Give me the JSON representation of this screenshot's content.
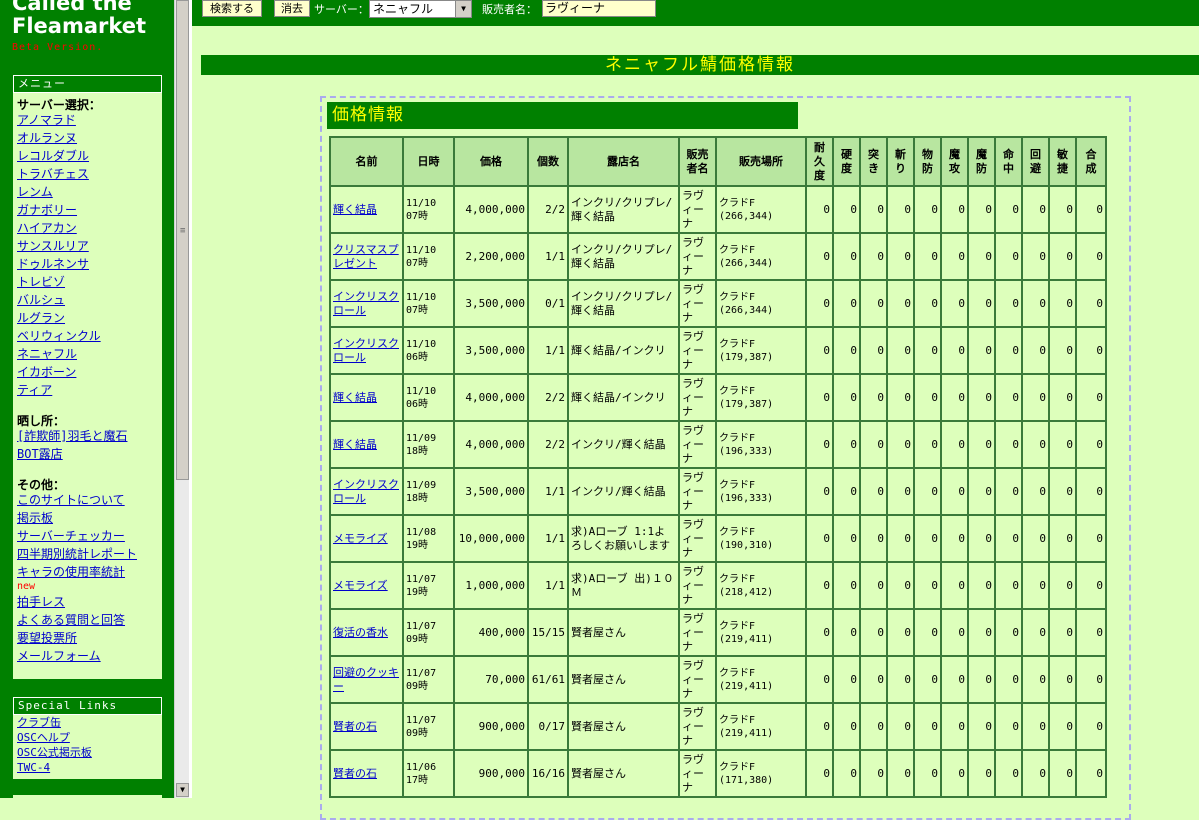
{
  "site": {
    "title_line1": "Called the",
    "title_line2": "Fleamarket",
    "beta": "Beta Version."
  },
  "menu": {
    "header": "メニュー",
    "server_section": "サーバー選択：",
    "servers": [
      "アノマラド",
      "オルランヌ",
      "レコルダブル",
      "トラバチェス",
      "レンム",
      "ガナボリー",
      "ハイアカン",
      "サンスルリア",
      "ドゥルネンサ",
      "トレビゾ",
      "バルシュ",
      "ルグラン",
      "ベリウィンクル",
      "ネニャフル",
      "イカボーン",
      "ティア"
    ],
    "exposure_section": "晒し所：",
    "exposure_links": [
      "[詐欺師]羽毛と魔石",
      "BOT露店"
    ],
    "other_section": "その他：",
    "other_links_a": [
      "このサイトについて",
      "掲示板",
      "サーバーチェッカー",
      "四半期別統計レポート",
      "キャラの使用率統計"
    ],
    "new_tag": "new",
    "other_links_b": [
      "拍手レス",
      "よくある質問と回答",
      "要望投票所",
      "メールフォーム"
    ]
  },
  "special": {
    "header": "Special Links",
    "links": [
      "クラブ缶",
      "OSCヘルプ",
      "OSC公式掲示板",
      "TWC-4"
    ]
  },
  "form": {
    "search_button": "検索する",
    "clear_button": "消去",
    "server_label": "サーバー：",
    "server_value": "ネニャフル",
    "seller_label": "販売者名：",
    "seller_value": "ラヴィーナ"
  },
  "banner": "ネニャフル鯖価格情報",
  "panel_title": "価格情報",
  "table": {
    "headers": [
      "名前",
      "日時",
      "価格",
      "個数",
      "露店名",
      "販売者名",
      "販売場所",
      "耐久度",
      "硬度",
      "突き",
      "斬り",
      "物防",
      "魔攻",
      "魔防",
      "命中",
      "回避",
      "敏捷",
      "合成"
    ],
    "rows": [
      {
        "name": "輝く結晶",
        "date": "11/10 07時",
        "price": "4,000,000",
        "qty": "2/2",
        "shop": "インクリ/クリプレ/輝く結晶",
        "seller": "ラヴィーナ",
        "loc": "クラドF (266,344)",
        "stats": [
          "0",
          "0",
          "0",
          "0",
          "0",
          "0",
          "0",
          "0",
          "0",
          "0",
          "0"
        ]
      },
      {
        "name": "クリスマスプレゼント",
        "date": "11/10 07時",
        "price": "2,200,000",
        "qty": "1/1",
        "shop": "インクリ/クリプレ/輝く結晶",
        "seller": "ラヴィーナ",
        "loc": "クラドF (266,344)",
        "stats": [
          "0",
          "0",
          "0",
          "0",
          "0",
          "0",
          "0",
          "0",
          "0",
          "0",
          "0"
        ]
      },
      {
        "name": "インクリスクロール",
        "date": "11/10 07時",
        "price": "3,500,000",
        "qty": "0/1",
        "shop": "インクリ/クリプレ/輝く結晶",
        "seller": "ラヴィーナ",
        "loc": "クラドF (266,344)",
        "stats": [
          "0",
          "0",
          "0",
          "0",
          "0",
          "0",
          "0",
          "0",
          "0",
          "0",
          "0"
        ]
      },
      {
        "name": "インクリスクロール",
        "date": "11/10 06時",
        "price": "3,500,000",
        "qty": "1/1",
        "shop": "輝く結晶/インクリ",
        "seller": "ラヴィーナ",
        "loc": "クラドF (179,387)",
        "stats": [
          "0",
          "0",
          "0",
          "0",
          "0",
          "0",
          "0",
          "0",
          "0",
          "0",
          "0"
        ]
      },
      {
        "name": "輝く結晶",
        "date": "11/10 06時",
        "price": "4,000,000",
        "qty": "2/2",
        "shop": "輝く結晶/インクリ",
        "seller": "ラヴィーナ",
        "loc": "クラドF (179,387)",
        "stats": [
          "0",
          "0",
          "0",
          "0",
          "0",
          "0",
          "0",
          "0",
          "0",
          "0",
          "0"
        ]
      },
      {
        "name": "輝く結晶",
        "date": "11/09 18時",
        "price": "4,000,000",
        "qty": "2/2",
        "shop": "インクリ/輝く結晶",
        "seller": "ラヴィーナ",
        "loc": "クラドF (196,333)",
        "stats": [
          "0",
          "0",
          "0",
          "0",
          "0",
          "0",
          "0",
          "0",
          "0",
          "0",
          "0"
        ]
      },
      {
        "name": "インクリスクロール",
        "date": "11/09 18時",
        "price": "3,500,000",
        "qty": "1/1",
        "shop": "インクリ/輝く結晶",
        "seller": "ラヴィーナ",
        "loc": "クラドF (196,333)",
        "stats": [
          "0",
          "0",
          "0",
          "0",
          "0",
          "0",
          "0",
          "0",
          "0",
          "0",
          "0"
        ]
      },
      {
        "name": "メモライズ",
        "date": "11/08 19時",
        "price": "10,000,000",
        "qty": "1/1",
        "shop": "求)Aローブ 1:1よろしくお願いします",
        "seller": "ラヴィーナ",
        "loc": "クラドF (190,310)",
        "stats": [
          "0",
          "0",
          "0",
          "0",
          "0",
          "0",
          "0",
          "0",
          "0",
          "0",
          "0"
        ]
      },
      {
        "name": "メモライズ",
        "date": "11/07 19時",
        "price": "1,000,000",
        "qty": "1/1",
        "shop": "求)Aローブ 出)１０Ｍ",
        "seller": "ラヴィーナ",
        "loc": "クラドF (218,412)",
        "stats": [
          "0",
          "0",
          "0",
          "0",
          "0",
          "0",
          "0",
          "0",
          "0",
          "0",
          "0"
        ]
      },
      {
        "name": "復活の香水",
        "date": "11/07 09時",
        "price": "400,000",
        "qty": "15/15",
        "shop": "賢者屋さん",
        "seller": "ラヴィーナ",
        "loc": "クラドF (219,411)",
        "stats": [
          "0",
          "0",
          "0",
          "0",
          "0",
          "0",
          "0",
          "0",
          "0",
          "0",
          "0"
        ]
      },
      {
        "name": "回避のクッキー",
        "date": "11/07 09時",
        "price": "70,000",
        "qty": "61/61",
        "shop": "賢者屋さん",
        "seller": "ラヴィーナ",
        "loc": "クラドF (219,411)",
        "stats": [
          "0",
          "0",
          "0",
          "0",
          "0",
          "0",
          "0",
          "0",
          "0",
          "0",
          "0"
        ]
      },
      {
        "name": "賢者の石",
        "date": "11/07 09時",
        "price": "900,000",
        "qty": "0/17",
        "shop": "賢者屋さん",
        "seller": "ラヴィーナ",
        "loc": "クラドF (219,411)",
        "stats": [
          "0",
          "0",
          "0",
          "0",
          "0",
          "0",
          "0",
          "0",
          "0",
          "0",
          "0"
        ]
      },
      {
        "name": "賢者の石",
        "date": "11/06 17時",
        "price": "900,000",
        "qty": "16/16",
        "shop": "賢者屋さん",
        "seller": "ラヴィーナ",
        "loc": "クラドF (171,380)",
        "stats": [
          "0",
          "0",
          "0",
          "0",
          "0",
          "0",
          "0",
          "0",
          "0",
          "0",
          "0"
        ]
      }
    ]
  }
}
